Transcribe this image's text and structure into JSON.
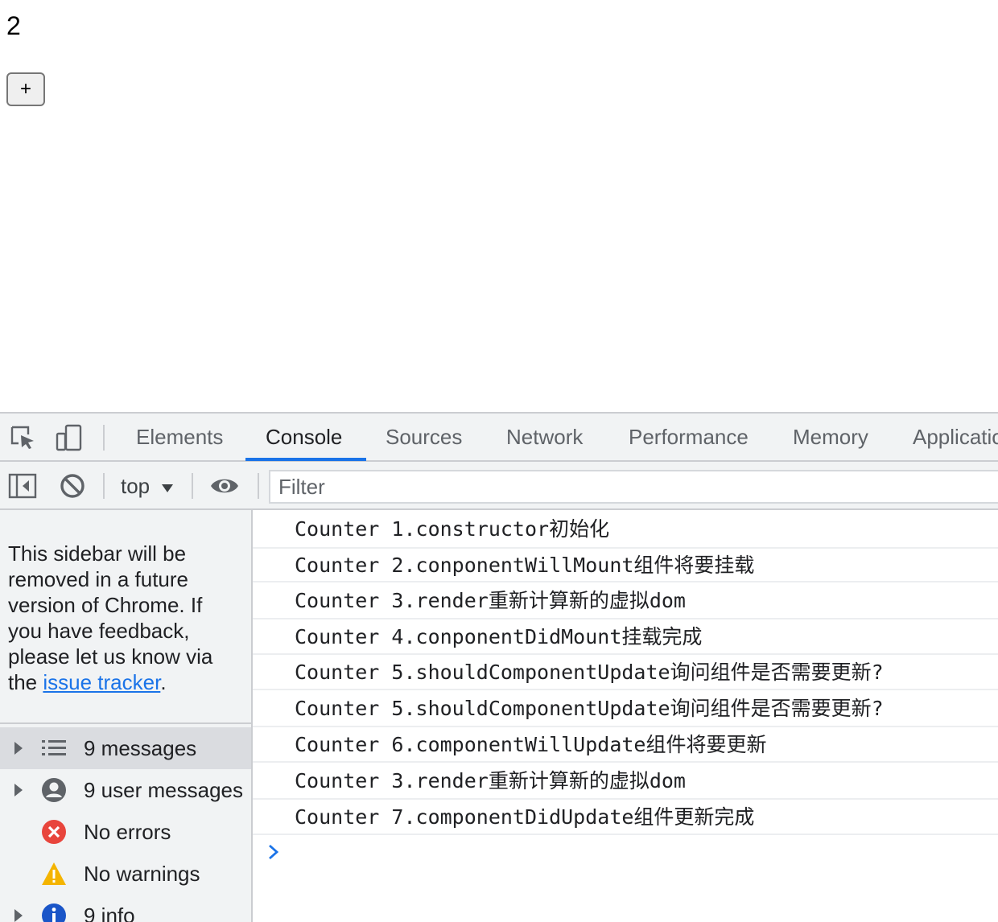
{
  "page": {
    "counter_value": "2",
    "plus_button_label": "+"
  },
  "devtools": {
    "tabs": [
      {
        "label": "Elements",
        "active": false
      },
      {
        "label": "Console",
        "active": true
      },
      {
        "label": "Sources",
        "active": false
      },
      {
        "label": "Network",
        "active": false
      },
      {
        "label": "Performance",
        "active": false
      },
      {
        "label": "Memory",
        "active": false
      },
      {
        "label": "Applicatio",
        "active": false
      }
    ],
    "toolbar": {
      "context": "top",
      "filter_placeholder": "Filter"
    },
    "sidebar": {
      "note_text": "This sidebar will be removed in a future version of Chrome. If you have feedback, please let us know via the ",
      "note_link": "issue tracker",
      "note_end": ".",
      "items": [
        {
          "label": "9 messages",
          "icon": "list-icon",
          "expandable": true,
          "selected": true
        },
        {
          "label": "9 user messages",
          "icon": "user-icon",
          "expandable": true,
          "selected": false
        },
        {
          "label": "No errors",
          "icon": "error-icon",
          "expandable": false,
          "selected": false
        },
        {
          "label": "No warnings",
          "icon": "warning-icon",
          "expandable": false,
          "selected": false
        },
        {
          "label": "9 info",
          "icon": "info-icon",
          "expandable": true,
          "selected": false
        }
      ]
    },
    "console_messages": [
      "Counter 1.constructor初始化",
      "Counter 2.conponentWillMount组件将要挂载",
      "Counter 3.render重新计算新的虚拟dom",
      "Counter 4.conponentDidMount挂载完成",
      "Counter 5.shouldComponentUpdate询问组件是否需要更新?",
      "Counter 5.shouldComponentUpdate询问组件是否需要更新?",
      "Counter 6.componentWillUpdate组件将要更新",
      "Counter 3.render重新计算新的虚拟dom",
      "Counter 7.componentDidUpdate组件更新完成"
    ],
    "colors": {
      "accent": "#1a73e8",
      "panel_bg": "#f1f3f4",
      "error": "#e8453c",
      "warning": "#f4b400"
    }
  }
}
